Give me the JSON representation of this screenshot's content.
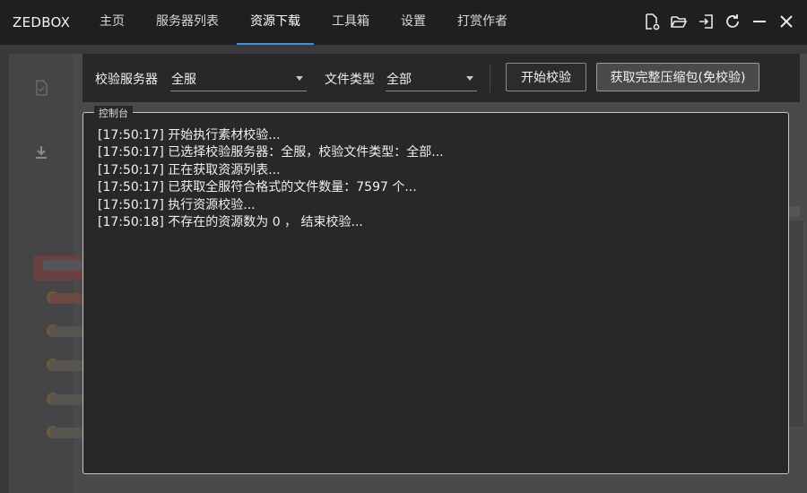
{
  "app": {
    "title": "ZEDBOX"
  },
  "nav": {
    "tabs": [
      {
        "label": "主页"
      },
      {
        "label": "服务器列表"
      },
      {
        "label": "资源下载",
        "active": true
      },
      {
        "label": "工具箱"
      },
      {
        "label": "设置"
      },
      {
        "label": "打赏作者"
      }
    ]
  },
  "window_controls": [
    "file-settings-icon",
    "folder-open-icon",
    "login-icon",
    "refresh-icon",
    "minimize-icon",
    "close-icon"
  ],
  "toolbar": {
    "server_label": "校验服务器",
    "server_value": "全服",
    "filetype_label": "文件类型",
    "filetype_value": "全部",
    "start_button": "开始校验",
    "package_button": "获取完整压缩包(免校验)"
  },
  "console": {
    "title": "控制台",
    "lines": [
      "[17:50:17] 开始执行素材校验...",
      "[17:50:17] 已选择校验服务器：全服，校验文件类型：全部...",
      "[17:50:17] 正在获取资源列表...",
      "[17:50:17] 已获取全服符合格式的文件数量：7597 个...",
      "[17:50:17] 执行资源校验...",
      "[17:50:18] 不存在的资源数为 0 ， 结束校验..."
    ]
  },
  "colors": {
    "titlebar_bg": "#1f1f21",
    "active_tab_underline": "#3f8fd8",
    "console_border": "#c4c4c4",
    "text": "#f0f0f0"
  }
}
